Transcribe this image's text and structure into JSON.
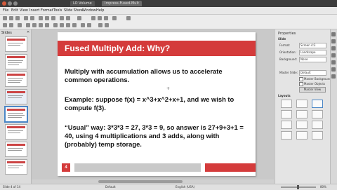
{
  "window": {
    "tab_labels": [
      "LO Volume",
      "Impress-Fused-Mult"
    ]
  },
  "menubar": {
    "items": [
      "File",
      "Edit",
      "View",
      "Insert",
      "Format",
      "Tools",
      "Slide Show",
      "Window",
      "Help"
    ]
  },
  "slides_pane": {
    "title": "Slides"
  },
  "slide": {
    "title": "Fused Multiply Add: Why?",
    "paragraphs": [
      "Multiply with accumulation allows us to accelerate common operations.",
      "Example: suppose f(x) = x^3+x^2+x+1, and we wish to compute f(3).",
      "“Usual” way: 3*3*3 = 27, 3*3 = 9, so answer is 27+9+3+1 = 40, using 4 multiplications and 3 adds, along with (probably) temp storage."
    ],
    "number": "4"
  },
  "properties": {
    "panel_title": "Properties",
    "section_slide": "Slide",
    "format_label": "Format:",
    "format_value": "Screen 4:3",
    "orientation_label": "Orientation:",
    "orientation_value": "Landscape",
    "background_label": "Background:",
    "background_value": "None",
    "master_label": "Master Slide:",
    "master_value": "Default",
    "check_bg": "Master Background",
    "check_obj": "Master Objects",
    "master_button": "Master View",
    "layouts_title": "Layouts"
  },
  "status": {
    "slide_info": "Slide 4 of 14",
    "master": "Default",
    "language": "English (USA)",
    "zoom": "80%"
  },
  "colors": {
    "accent_red": "#d43b3b"
  }
}
